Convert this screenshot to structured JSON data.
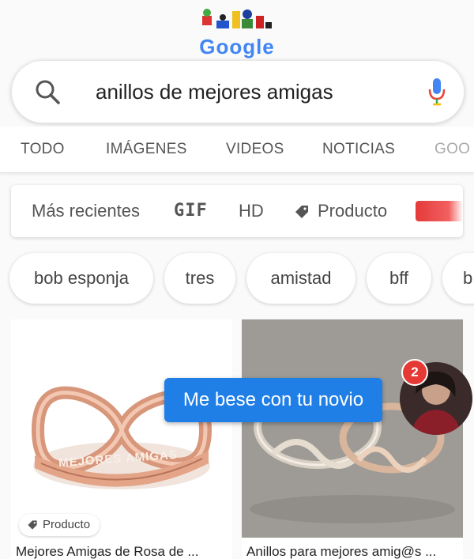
{
  "logo": {
    "text": "Google"
  },
  "search": {
    "query": "anillos de mejores amigas"
  },
  "tabs": [
    {
      "label": "TODO"
    },
    {
      "label": "IMÁGENES"
    },
    {
      "label": "VIDEOS"
    },
    {
      "label": "NOTICIAS"
    },
    {
      "label": "GOO"
    }
  ],
  "filters": {
    "recent": "Más recientes",
    "gif": "GIF",
    "hd": "HD",
    "product": "Producto",
    "color_swatch": "#e43a3a"
  },
  "chips": [
    {
      "label": "bob esponja"
    },
    {
      "label": "tres"
    },
    {
      "label": "amistad"
    },
    {
      "label": "bff"
    },
    {
      "label": "b"
    }
  ],
  "results": [
    {
      "title": "Mejores Amigas de Rosa de ...",
      "badge": "Producto",
      "engraving": "MEJORES AMIGAS"
    },
    {
      "title": "Anillos para mejores amig@s ..."
    }
  ],
  "overlay": {
    "message": "Me bese con tu novio",
    "badge_count": "2"
  },
  "colors": {
    "accent_blue": "#1f7fe6",
    "badge_red": "#e53935",
    "rose_gold": "#d8967a"
  }
}
